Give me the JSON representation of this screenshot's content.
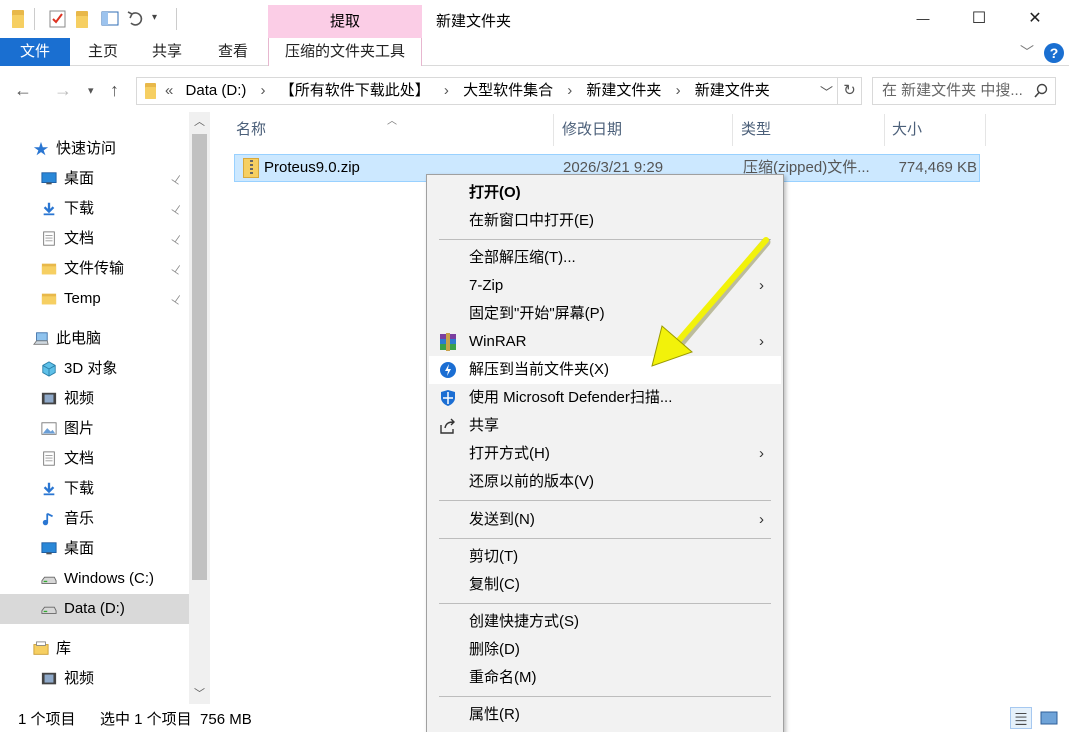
{
  "window": {
    "title": "新建文件夹",
    "context_tab_header": "提取",
    "controls": {
      "minimize": "—",
      "maximize": "☐",
      "close": "✕"
    }
  },
  "ribbon": {
    "tabs": [
      {
        "label": "文件"
      },
      {
        "label": "主页"
      },
      {
        "label": "共享"
      },
      {
        "label": "查看"
      },
      {
        "label": "压缩的文件夹工具"
      }
    ],
    "help": "?"
  },
  "address": {
    "prefix": "«",
    "crumbs": [
      "Data (D:)",
      "【所有软件下载此处】",
      "大型软件集合",
      "新建文件夹",
      "新建文件夹"
    ],
    "separator": "›",
    "search_placeholder": "在 新建文件夹 中搜..."
  },
  "nav": {
    "items": [
      {
        "label": "快速访问",
        "icon": "star-icon",
        "pinned": false
      },
      {
        "label": "桌面",
        "icon": "desktop-icon",
        "pinned": true
      },
      {
        "label": "下载",
        "icon": "download-icon",
        "pinned": true
      },
      {
        "label": "文档",
        "icon": "document-icon",
        "pinned": true
      },
      {
        "label": "文件传输",
        "icon": "folder-icon",
        "pinned": true
      },
      {
        "label": "Temp",
        "icon": "folder-icon",
        "pinned": true
      },
      {
        "label": "此电脑",
        "icon": "computer-icon",
        "pinned": false
      },
      {
        "label": "3D 对象",
        "icon": "cube-icon",
        "pinned": false
      },
      {
        "label": "视频",
        "icon": "video-icon",
        "pinned": false
      },
      {
        "label": "图片",
        "icon": "picture-icon",
        "pinned": false
      },
      {
        "label": "文档",
        "icon": "document-icon",
        "pinned": false
      },
      {
        "label": "下载",
        "icon": "download-icon",
        "pinned": false
      },
      {
        "label": "音乐",
        "icon": "music-icon",
        "pinned": false
      },
      {
        "label": "桌面",
        "icon": "desktop-icon",
        "pinned": false
      },
      {
        "label": "Windows (C:)",
        "icon": "drive-icon",
        "pinned": false
      },
      {
        "label": "Data (D:)",
        "icon": "drive-icon",
        "pinned": false,
        "selected": true
      },
      {
        "label": "库",
        "icon": "library-icon",
        "pinned": false
      },
      {
        "label": "视频",
        "icon": "video-icon",
        "pinned": false
      }
    ],
    "pin_glyph": "📌"
  },
  "filelist": {
    "columns": {
      "name": "名称",
      "modified": "修改日期",
      "type": "类型",
      "size": "大小"
    },
    "rows": [
      {
        "name": "Proteus9.0.zip",
        "modified": "2026/3/21 9:29",
        "type": "压缩(zipped)文件...",
        "size": "774,469 KB",
        "selected": true
      }
    ]
  },
  "status": {
    "count": "1 个项目",
    "selection": "选中 1 个项目  756 MB"
  },
  "context_menu": {
    "items": {
      "open": "打开(O)",
      "open_new_window": "在新窗口中打开(E)",
      "extract_all": "全部解压缩(T)...",
      "sevenzip": "7-Zip",
      "pin_start": "固定到\"开始\"屏幕(P)",
      "winrar": "WinRAR",
      "extract_here": "解压到当前文件夹(X)",
      "defender": "使用 Microsoft Defender扫描...",
      "share": "共享",
      "open_with": "打开方式(H)",
      "restore_versions": "还原以前的版本(V)",
      "send_to": "发送到(N)",
      "cut": "剪切(T)",
      "copy": "复制(C)",
      "create_shortcut": "创建快捷方式(S)",
      "delete": "删除(D)",
      "rename": "重命名(M)",
      "properties": "属性(R)"
    },
    "submenu_glyph": "›",
    "highlighted": "extract_here"
  },
  "colors": {
    "accent": "#1a6fd1",
    "context_tab": "#fbcde6",
    "selection": "#cce8ff",
    "annotation_arrow": "#f2f20a"
  }
}
